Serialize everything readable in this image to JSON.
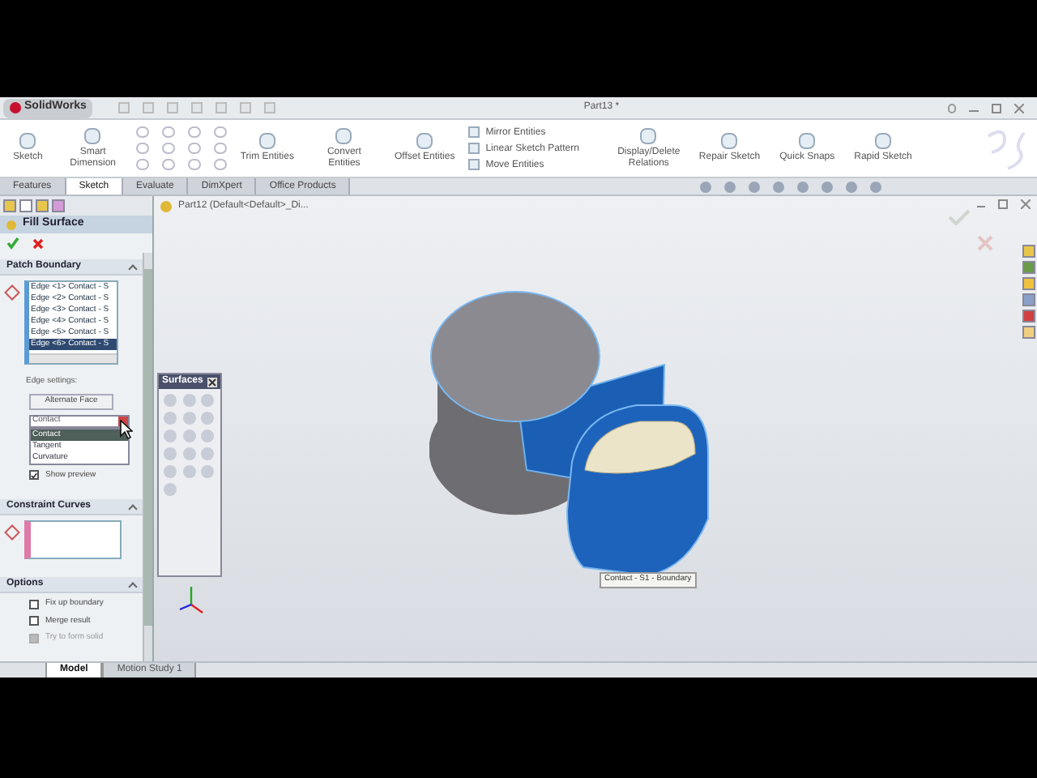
{
  "app": {
    "title": "SolidWorks",
    "document_title": "Part13 *"
  },
  "ribbon": [
    {
      "label": "Sketch",
      "kind": "large"
    },
    {
      "label": "Smart Dimension",
      "kind": "large"
    },
    {
      "label": "Trim Entities",
      "kind": "large"
    },
    {
      "label": "Convert Entities",
      "kind": "large"
    },
    {
      "label": "Offset Entities",
      "kind": "large"
    },
    {
      "label": "Mirror Entities",
      "kind": "small"
    },
    {
      "label": "Linear Sketch Pattern",
      "kind": "small"
    },
    {
      "label": "Move Entities",
      "kind": "small"
    },
    {
      "label": "Display/Delete Relations",
      "kind": "large"
    },
    {
      "label": "Repair Sketch",
      "kind": "large"
    },
    {
      "label": "Quick Snaps",
      "kind": "large"
    },
    {
      "label": "Rapid Sketch",
      "kind": "large"
    }
  ],
  "tabs": [
    {
      "label": "Features",
      "selected": false
    },
    {
      "label": "Sketch",
      "selected": true
    },
    {
      "label": "Evaluate",
      "selected": false
    },
    {
      "label": "DimXpert",
      "selected": false
    },
    {
      "label": "Office Products",
      "selected": false
    }
  ],
  "tree": {
    "root": "Part12 (Default<Default>_Di..."
  },
  "property_manager": {
    "title": "Fill Surface",
    "patch_boundary": {
      "header": "Patch Boundary",
      "edges": [
        {
          "label": "Edge <1> Contact - S",
          "selected": false
        },
        {
          "label": "Edge <2> Contact - S",
          "selected": false
        },
        {
          "label": "Edge <3> Contact - S",
          "selected": false
        },
        {
          "label": "Edge <4> Contact - S",
          "selected": false
        },
        {
          "label": "Edge <5> Contact - S",
          "selected": false
        },
        {
          "label": "Edge <6> Contact - S",
          "selected": true
        }
      ],
      "edge_settings_label": "Edge settings:",
      "alternate_face_button": "Alternate Face",
      "dropdown": {
        "value": "Contact",
        "options": [
          {
            "label": "Contact",
            "selected": true
          },
          {
            "label": "Tangent",
            "selected": false
          },
          {
            "label": "Curvature",
            "selected": false
          }
        ]
      },
      "show_preview": {
        "label": "Show preview",
        "checked": true
      }
    },
    "constraint_curves": {
      "header": "Constraint Curves"
    },
    "options": {
      "header": "Options",
      "items": [
        {
          "label": "Fix up boundary",
          "checked": false,
          "disabled": false
        },
        {
          "label": "Merge result",
          "checked": false,
          "disabled": false
        },
        {
          "label": "Try to form solid",
          "checked": false,
          "disabled": true
        }
      ]
    }
  },
  "surfaces_toolbar": {
    "title": "Surfaces"
  },
  "callout": "Contact - S1 - Boundary",
  "bottom_tabs": [
    {
      "label": "Model",
      "selected": true
    },
    {
      "label": "Motion Study 1",
      "selected": false
    }
  ]
}
